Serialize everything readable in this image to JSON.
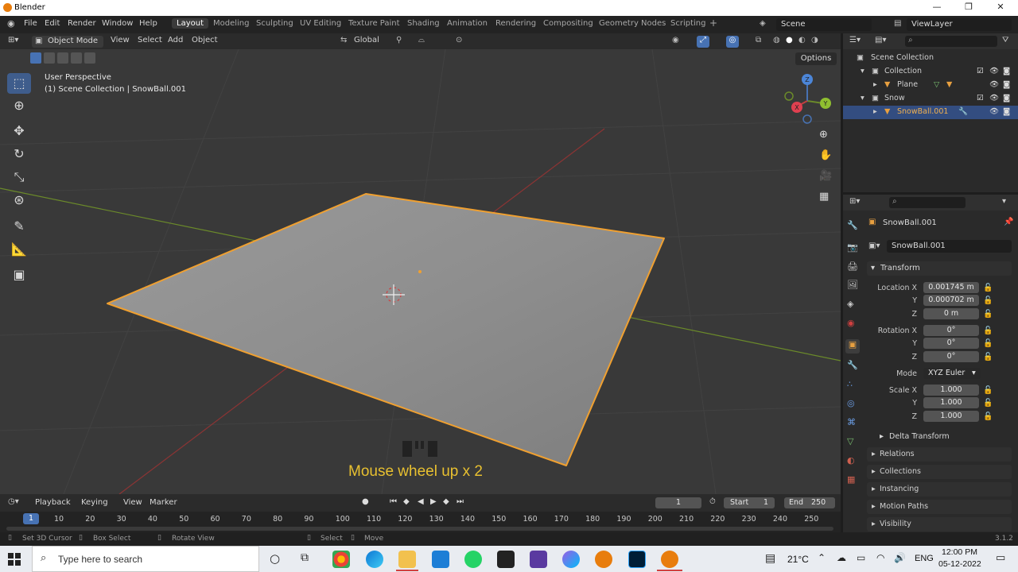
{
  "title_bar": {
    "app_title": "Blender",
    "minimize": "—",
    "maximize": "❐",
    "close": "✕"
  },
  "menu": {
    "items": [
      "File",
      "Edit",
      "Render",
      "Window",
      "Help"
    ],
    "workspaces": [
      "Layout",
      "Modeling",
      "Sculpting",
      "UV Editing",
      "Texture Paint",
      "Shading",
      "Animation",
      "Rendering",
      "Compositing",
      "Geometry Nodes",
      "Scripting"
    ],
    "add_tab": "+",
    "scene": "Scene",
    "view_layer": "ViewLayer"
  },
  "viewport_header": {
    "mode": "Object Mode",
    "menus": [
      "View",
      "Select",
      "Add",
      "Object"
    ],
    "orientation": "Global",
    "options": "Options"
  },
  "viewport": {
    "perspective": "User Perspective",
    "collection_info": "(1) Scene Collection | SnowBall.001",
    "overlay_caption": "Mouse wheel up x 2",
    "gizmo_axes": {
      "x": "X",
      "y": "Y",
      "z": "Z"
    }
  },
  "outliner": {
    "rows": [
      {
        "label": "Scene Collection"
      },
      {
        "label": "Collection"
      },
      {
        "label": "Plane"
      },
      {
        "label": "Snow"
      },
      {
        "label": "SnowBall.001"
      }
    ]
  },
  "properties": {
    "object_name": "SnowBall.001",
    "data_name": "SnowBall.001",
    "transform_title": "Transform",
    "location": {
      "label": "Location X",
      "x": "0.001745 m",
      "y": "0.000702 m",
      "z": "0 m"
    },
    "rotation": {
      "label": "Rotation X",
      "x": "0°",
      "y": "0°",
      "z": "0°"
    },
    "mode": {
      "label": "Mode",
      "value": "XYZ Euler"
    },
    "scale": {
      "label": "Scale X",
      "x": "1.000",
      "y": "1.000",
      "z": "1.000"
    },
    "axis_y": "Y",
    "axis_z": "Z",
    "delta_transform": "Delta Transform",
    "panels": [
      "Relations",
      "Collections",
      "Instancing",
      "Motion Paths",
      "Visibility"
    ]
  },
  "timeline": {
    "menus": [
      "Playback",
      "Keying",
      "View",
      "Marker"
    ],
    "current_frame": "1",
    "start_label": "Start",
    "start": "1",
    "end_label": "End",
    "end": "250",
    "frame_marker": "1",
    "ticks": [
      "10",
      "20",
      "30",
      "40",
      "50",
      "60",
      "70",
      "80",
      "90",
      "100",
      "110",
      "120",
      "130",
      "140",
      "150",
      "160",
      "170",
      "180",
      "190",
      "200",
      "210",
      "220",
      "230",
      "240",
      "250"
    ]
  },
  "status_bar": {
    "left": "Set 3D Cursor",
    "box_select": "Box Select",
    "rotate_view": "Rotate View",
    "select": "Select",
    "move": "Move",
    "version": "3.1.2"
  },
  "taskbar": {
    "search_placeholder": "Type here to search",
    "weather": "21°C",
    "language": "ENG",
    "time": "12:00 PM",
    "date": "05-12-2022"
  },
  "colors": {
    "selection_orange": "#f0a030",
    "axis_red": "#8c3434",
    "axis_green": "#6b8a2a",
    "caption_yellow": "#e8c030",
    "active_blue": "#4772b3"
  }
}
